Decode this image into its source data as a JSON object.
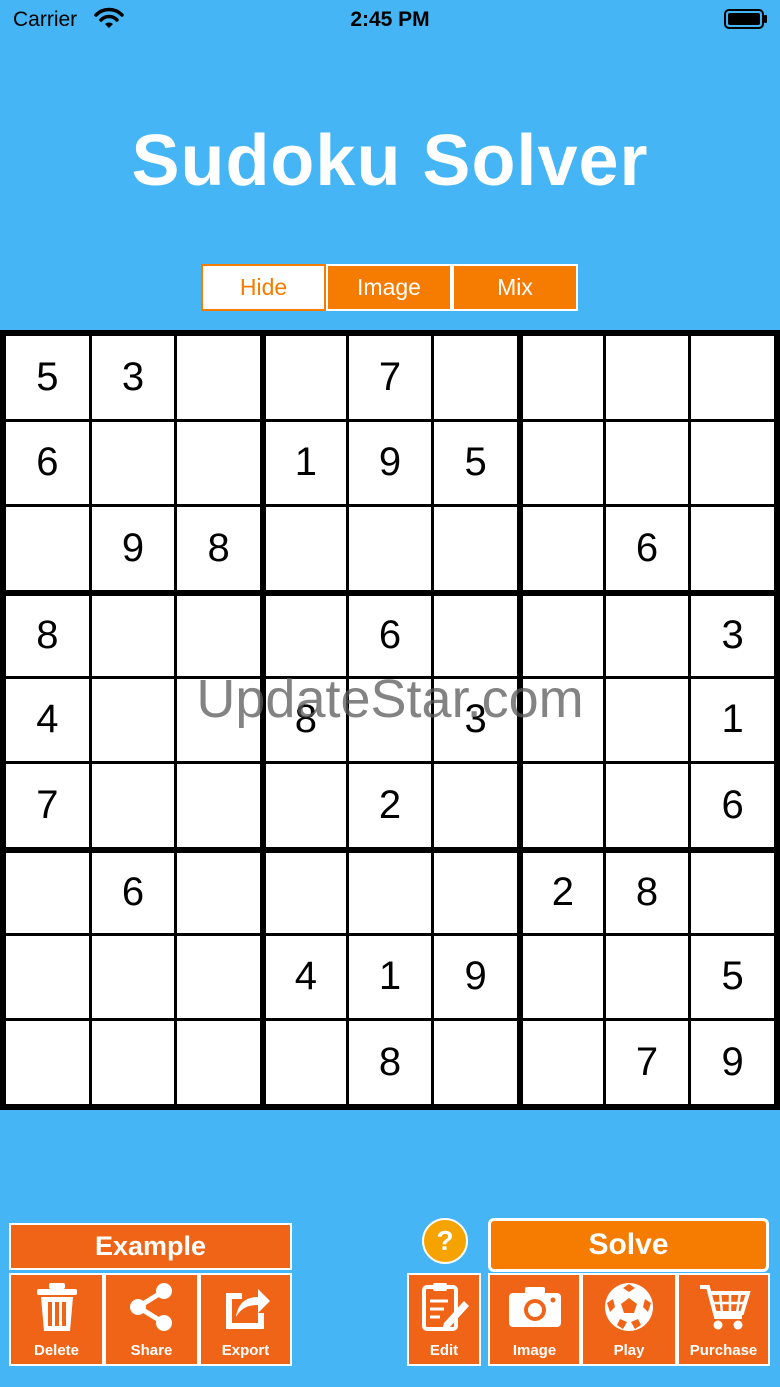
{
  "status": {
    "carrier": "Carrier",
    "time": "2:45 PM"
  },
  "title": "Sudoku Solver",
  "segments": {
    "hide": "Hide",
    "image": "Image",
    "mix": "Mix",
    "selected": "Hide"
  },
  "grid": [
    [
      "5",
      "3",
      "",
      "",
      "7",
      "",
      "",
      "",
      ""
    ],
    [
      "6",
      "",
      "",
      "1",
      "9",
      "5",
      "",
      "",
      ""
    ],
    [
      "",
      "9",
      "8",
      "",
      "",
      "",
      "",
      "6",
      ""
    ],
    [
      "8",
      "",
      "",
      "",
      "6",
      "",
      "",
      "",
      "3"
    ],
    [
      "4",
      "",
      "",
      "8",
      "",
      "3",
      "",
      "",
      "1"
    ],
    [
      "7",
      "",
      "",
      "",
      "2",
      "",
      "",
      "",
      "6"
    ],
    [
      "",
      "6",
      "",
      "",
      "",
      "",
      "2",
      "8",
      ""
    ],
    [
      "",
      "",
      "",
      "4",
      "1",
      "9",
      "",
      "",
      "5"
    ],
    [
      "",
      "",
      "",
      "",
      "8",
      "",
      "",
      "7",
      "9"
    ]
  ],
  "watermark": "UpdateStar.com",
  "buttons": {
    "example": "Example",
    "solve": "Solve",
    "help": "?",
    "delete": "Delete",
    "share": "Share",
    "export": "Export",
    "edit": "Edit",
    "image": "Image",
    "play": "Play",
    "purchase": "Purchase"
  },
  "colors": {
    "background": "#45b5f5",
    "accent": "#f57c00",
    "button": "#ef6416"
  }
}
